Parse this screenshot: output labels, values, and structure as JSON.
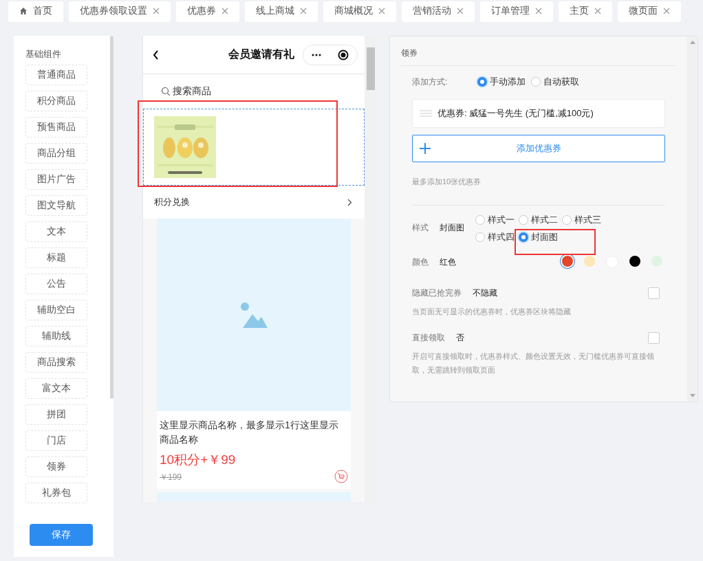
{
  "tabs": [
    {
      "label": "首页",
      "kind": "home",
      "selected": false
    },
    {
      "label": "优惠券领取设置",
      "kind": "page",
      "selected": false
    },
    {
      "label": "优惠券",
      "kind": "page",
      "selected": false
    },
    {
      "label": "线上商城",
      "kind": "page",
      "selected": false
    },
    {
      "label": "商城概况",
      "kind": "page",
      "selected": false
    },
    {
      "label": "营销活动",
      "kind": "page",
      "selected": false
    },
    {
      "label": "订单管理",
      "kind": "page",
      "selected": false
    },
    {
      "label": "主页",
      "kind": "page",
      "selected": false
    },
    {
      "label": "微页面",
      "kind": "page",
      "selected": false
    }
  ],
  "sidebar": {
    "title": "基础组件",
    "items": [
      "普通商品",
      "积分商品",
      "预售商品",
      "商品分组",
      "图片广告",
      "图文导航",
      "文本",
      "标题",
      "公告",
      "辅助空白",
      "辅助线",
      "商品搜索",
      "富文本",
      "拼团",
      "门店",
      "领券",
      "礼券包"
    ],
    "save_button": "保存"
  },
  "phone": {
    "title": "会员邀请有礼",
    "search_placeholder": "搜索商品",
    "points_row": "积分兑换",
    "product": {
      "name": "这里显示商品名称，最多显示1行这里显示商品名称",
      "price": "10积分+￥99",
      "original_price": "￥199"
    }
  },
  "settings": {
    "section_title": "领券",
    "add_mode": {
      "label": "添加方式:",
      "options": [
        {
          "label": "手动添加",
          "selected": true
        },
        {
          "label": "自动获取",
          "selected": false
        }
      ]
    },
    "coupons": [
      "优惠券: 威猛一号先生 (无门槛,减100元)"
    ],
    "add_button": "添加优惠券",
    "hint": "最多添加10张优惠券",
    "style": {
      "label": "样式",
      "value": "封面图",
      "options": [
        {
          "label": "样式一",
          "selected": false
        },
        {
          "label": "样式二",
          "selected": false
        },
        {
          "label": "样式三",
          "selected": false
        },
        {
          "label": "样式四",
          "selected": false
        },
        {
          "label": "封面图",
          "selected": true
        }
      ]
    },
    "color": {
      "label": "颜色",
      "value": "红色",
      "swatches": [
        {
          "color": "#e5452b",
          "selected": true
        },
        {
          "color": "#fde7b4",
          "selected": false
        },
        {
          "color": "#ffffff",
          "selected": false
        },
        {
          "color": "#000000",
          "selected": false
        },
        {
          "color": "#dff5e3",
          "selected": false
        }
      ]
    },
    "hide_sold_out": {
      "label": "隐藏已抢完券",
      "value": "不隐藏",
      "checked": false,
      "hint": "当页面无可显示的优惠券时，优惠券区块将隐藏"
    },
    "direct_claim": {
      "label": "直接领取",
      "value": "否",
      "checked": false,
      "hint": "开启可直接领取时，优惠券样式、颜色设置无效，无门槛优惠券可直接领取，无需跳转到领取页面"
    }
  }
}
